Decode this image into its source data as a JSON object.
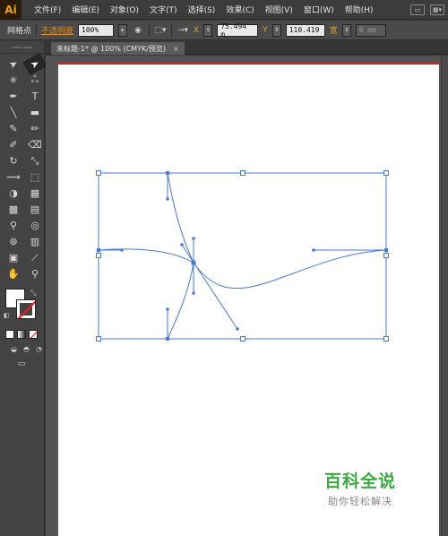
{
  "app": {
    "logo": "Ai"
  },
  "menu": {
    "items": [
      "文件(F)",
      "编辑(E)",
      "对象(O)",
      "文字(T)",
      "选择(S)",
      "效果(C)",
      "视图(V)",
      "窗口(W)",
      "帮助(H)"
    ]
  },
  "control_bar": {
    "selection_label": "网格点",
    "opacity_label": "不透明度",
    "opacity_value": "100%",
    "x_label": "X",
    "x_value": "75.494 m",
    "y_label": "Y",
    "y_value": "110.419",
    "w_value": "0 mm"
  },
  "document": {
    "tab_title": "未标题-1* @ 100% (CMYK/预览)",
    "close_glyph": "×"
  },
  "colors": {
    "accent": "#e8a317",
    "path_blue": "#4a78d6",
    "artboard_border": "#bd3030",
    "watermark_green": "#3aab3e"
  },
  "tools": [
    {
      "name": "selection-tool",
      "glyph": "➤"
    },
    {
      "name": "direct-selection-tool",
      "glyph": "➤"
    },
    {
      "name": "magic-wand-tool",
      "glyph": "✳"
    },
    {
      "name": "lasso-tool",
      "glyph": "ஃ"
    },
    {
      "name": "pen-tool",
      "glyph": "✒"
    },
    {
      "name": "type-tool",
      "glyph": "T"
    },
    {
      "name": "line-tool",
      "glyph": "╲"
    },
    {
      "name": "rectangle-tool",
      "glyph": "▬"
    },
    {
      "name": "paintbrush-tool",
      "glyph": "✎"
    },
    {
      "name": "pencil-tool",
      "glyph": "✏"
    },
    {
      "name": "blob-brush-tool",
      "glyph": "✐"
    },
    {
      "name": "eraser-tool",
      "glyph": "⌫"
    },
    {
      "name": "rotate-tool",
      "glyph": "↻"
    },
    {
      "name": "scale-tool",
      "glyph": "⤡"
    },
    {
      "name": "width-tool",
      "glyph": "⟿"
    },
    {
      "name": "free-transform-tool",
      "glyph": "⬚"
    },
    {
      "name": "shape-builder-tool",
      "glyph": "◑"
    },
    {
      "name": "perspective-grid-tool",
      "glyph": "▦"
    },
    {
      "name": "mesh-tool",
      "glyph": "▩"
    },
    {
      "name": "gradient-tool",
      "glyph": "▤"
    },
    {
      "name": "eyedropper-tool",
      "glyph": "⚲"
    },
    {
      "name": "blend-tool",
      "glyph": "◎"
    },
    {
      "name": "symbol-sprayer-tool",
      "glyph": "⊛"
    },
    {
      "name": "column-graph-tool",
      "glyph": "▥"
    },
    {
      "name": "artboard-tool",
      "glyph": "▣"
    },
    {
      "name": "slice-tool",
      "glyph": "⟋"
    },
    {
      "name": "hand-tool",
      "glyph": "✋"
    },
    {
      "name": "zoom-tool",
      "glyph": "⚲"
    }
  ],
  "watermark": {
    "title": "百科全说",
    "subtitle": "助你轻松解决"
  }
}
